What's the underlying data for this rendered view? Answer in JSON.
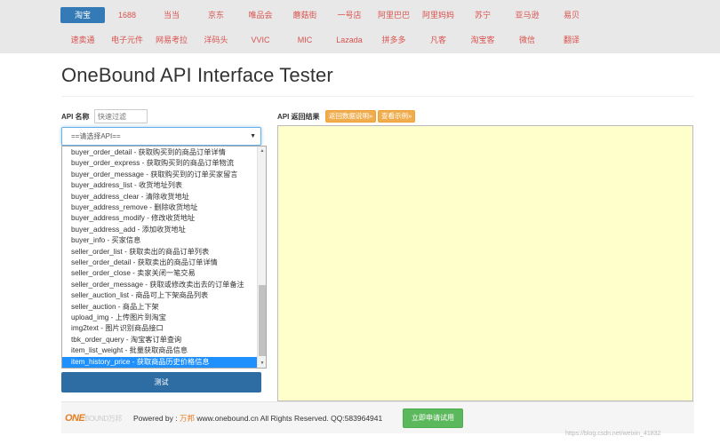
{
  "nav": {
    "row1": [
      "淘宝",
      "1688",
      "当当",
      "京东",
      "唯品会",
      "蘑菇街",
      "一号店",
      "阿里巴巴",
      "阿里妈妈",
      "苏宁",
      "亚马逊",
      "易贝"
    ],
    "row2": [
      "速卖通",
      "电子元件",
      "网易考拉",
      "洋码头",
      "VVIC",
      "MIC",
      "Lazada",
      "拼多多",
      "凡客",
      "淘宝客",
      "微信",
      "翻译"
    ],
    "active": "淘宝"
  },
  "page": {
    "title": "OneBound API Interface Tester"
  },
  "api": {
    "name_label": "API 名称",
    "filter_placeholder": "快速过滤",
    "select_value": "==请选择API==",
    "options": [
      "buyer_order_detail - 获取购买到的商品订单详情",
      "buyer_order_express - 获取购买到的商品订单物流",
      "buyer_order_message - 获取购买到的订单买家留言",
      "buyer_address_list - 收货地址列表",
      "buyer_address_clear - 清除收货地址",
      "buyer_address_remove - 删除收货地址",
      "buyer_address_modify - 修改收货地址",
      "buyer_address_add - 添加收货地址",
      "buyer_info - 买家信息",
      "seller_order_list - 获取卖出的商品订单列表",
      "seller_order_detail - 获取卖出的商品订单详情",
      "seller_order_close - 卖家关闭一笔交易",
      "seller_order_message - 获取或修改卖出去的订单备注",
      "seller_auction_list - 商品可上下架商品列表",
      "seller_auction - 商品上下架",
      "upload_img - 上传图片到淘宝",
      "img2text - 图片识别商品接口",
      "tbk_order_query - 淘宝客订单查询",
      "item_list_weight - 批量获取商品信息",
      "item_history_price - 获取商品历史价格信息"
    ],
    "selected_option": "item_history_price - 获取商品历史价格信息",
    "test_button": "测试"
  },
  "result": {
    "label": "API 返回结果",
    "doc_button": "返回数据说明»",
    "example_button": "查看示例»"
  },
  "footer": {
    "logo_main": "ONE",
    "logo_sub": "BOUND",
    "logo_cn": "万邦",
    "powered_prefix": "Powered by :",
    "powered_brand": "万邦",
    "powered_suffix": "www.onebound.cn All Rights Reserved. QQ:583964941",
    "try_button": "立即申请试用"
  },
  "watermark": "https://blog.csdn.net/weixin_41832",
  "colors": {
    "nav_bg": "#e8e8e8",
    "nav_text": "#d9534f",
    "nav_active": "#337ab7",
    "primary_btn": "#2e6da4",
    "warning_btn": "#f0ad4e",
    "success_btn": "#5cb85c",
    "result_bg": "#ffffcc",
    "selected_option": "#1e90ff"
  }
}
